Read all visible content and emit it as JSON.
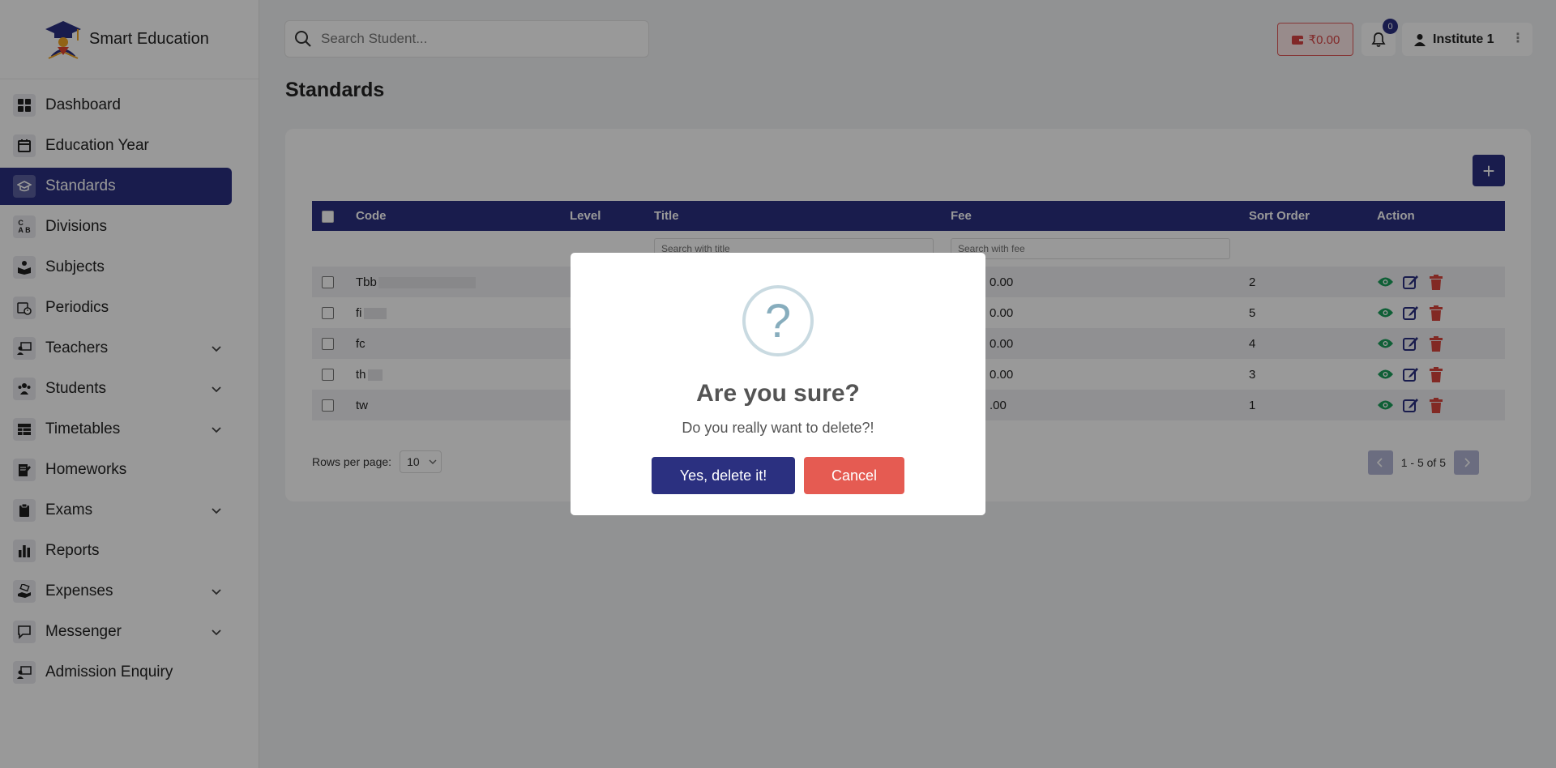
{
  "app": {
    "name": "Smart Education"
  },
  "sidebar": {
    "items": [
      {
        "label": "Dashboard",
        "icon": "dashboard-icon"
      },
      {
        "label": "Education Year",
        "icon": "calendar-icon"
      },
      {
        "label": "Standards",
        "icon": "graduation-cap-icon",
        "active": true
      },
      {
        "label": "Divisions",
        "icon": "abc-blocks-icon"
      },
      {
        "label": "Subjects",
        "icon": "book-reader-icon"
      },
      {
        "label": "Periodics",
        "icon": "calendar-clock-icon"
      },
      {
        "label": "Teachers",
        "icon": "chalkboard-teacher-icon",
        "expandable": true
      },
      {
        "label": "Students",
        "icon": "users-icon",
        "expandable": true
      },
      {
        "label": "Timetables",
        "icon": "table-icon",
        "expandable": true
      },
      {
        "label": "Homeworks",
        "icon": "notebook-pen-icon"
      },
      {
        "label": "Exams",
        "icon": "clipboard-icon",
        "expandable": true
      },
      {
        "label": "Reports",
        "icon": "bar-chart-icon"
      },
      {
        "label": "Expenses",
        "icon": "hand-money-icon",
        "expandable": true
      },
      {
        "label": "Messenger",
        "icon": "message-icon",
        "expandable": true
      },
      {
        "label": "Admission Enquiry",
        "icon": "teacher-board-icon"
      }
    ]
  },
  "header": {
    "search_placeholder": "Search Student...",
    "wallet": "₹0.00",
    "notifications_count": "0",
    "user": "Institute 1"
  },
  "page": {
    "title": "Standards"
  },
  "table": {
    "columns": [
      "Code",
      "Level",
      "Title",
      "Fee",
      "Sort Order",
      "Action"
    ],
    "filter_placeholders": {
      "title": "Search with title",
      "fee": "Search with fee"
    },
    "rows": [
      {
        "code": "Tbb",
        "fee": "0.00",
        "sort": "2"
      },
      {
        "code": "fi",
        "fee": "0.00",
        "sort": "5"
      },
      {
        "code": "fc",
        "fee": "0.00",
        "sort": "4"
      },
      {
        "code": "th",
        "fee": "0.00",
        "sort": "3"
      },
      {
        "code": "tw",
        "fee": ".00",
        "sort": "1"
      }
    ]
  },
  "pagination": {
    "rows_label": "Rows per page:",
    "rows_value": "10",
    "range": "1 - 5 of 5"
  },
  "modal": {
    "icon": "?",
    "title": "Are you sure?",
    "text": "Do you really want to delete?!",
    "confirm": "Yes, delete it!",
    "cancel": "Cancel"
  },
  "colors": {
    "primary": "#2b3080",
    "danger": "#e55b52",
    "success": "#1a9f5a"
  }
}
